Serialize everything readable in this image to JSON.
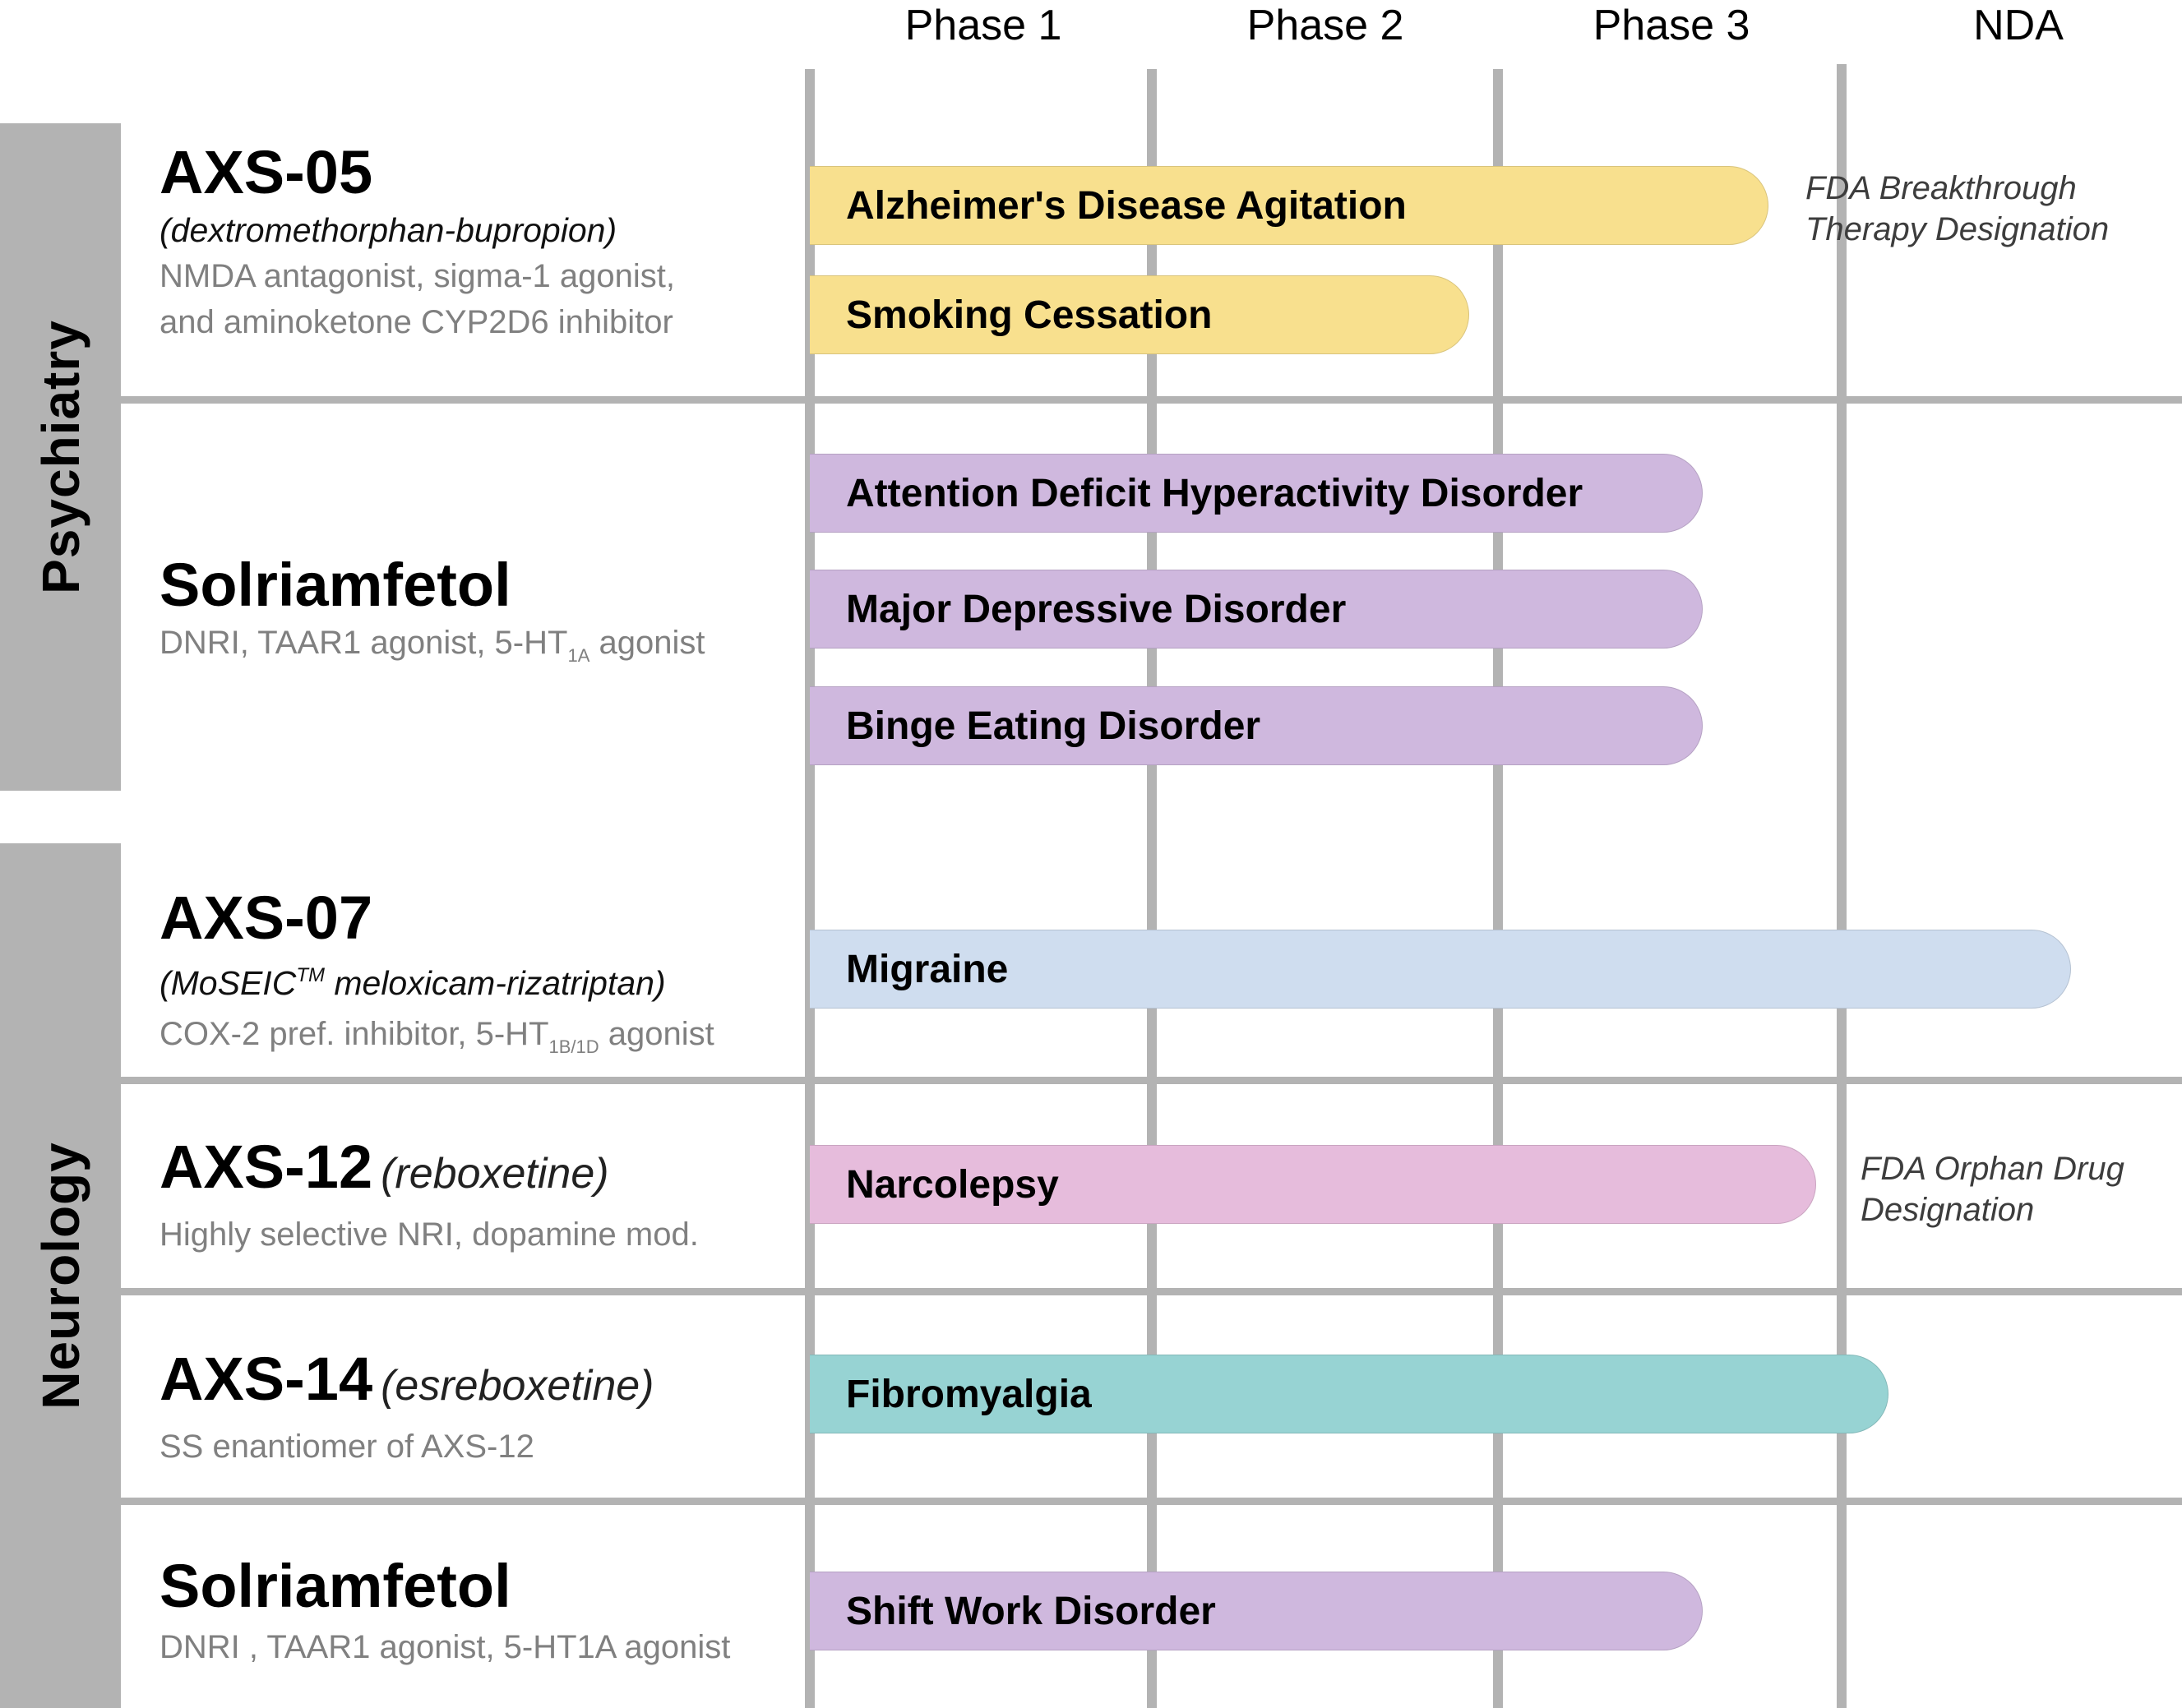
{
  "header": {
    "phases": [
      "Phase 1",
      "Phase 2",
      "Phase 3",
      "NDA"
    ]
  },
  "categories": {
    "psychiatry": "Psychiatry",
    "neurology": "Neurology"
  },
  "drugs": [
    {
      "name": "AXS-05",
      "compound": "(dextromethorphan-bupropion)",
      "mechanism_line1": "NMDA antagonist, sigma-1 agonist,",
      "mechanism_line2": "and aminoketone CYP2D6 inhibitor"
    },
    {
      "name": "Solriamfetol",
      "mechanism_pre": "DNRI, TAAR1 agonist, 5-HT",
      "mechanism_sub": "1A",
      "mechanism_post": " agonist"
    },
    {
      "name": "AXS-07",
      "compound_pre": "(MoSEIC",
      "compound_sup": "TM",
      "compound_post": " meloxicam-rizatriptan)",
      "mechanism_pre": "COX-2 pref. inhibitor, 5-HT",
      "mechanism_sub": "1B/1D",
      "mechanism_post": " agonist"
    },
    {
      "name": "AXS-12",
      "compound": "(reboxetine)",
      "mechanism": "Highly selective NRI, dopamine mod."
    },
    {
      "name": "AXS-14",
      "compound": "(esreboxetine)",
      "mechanism": "SS enantiomer of AXS-12"
    },
    {
      "name": "Solriamfetol",
      "mechanism": "DNRI , TAAR1 agonist, 5-HT1A agonist"
    }
  ],
  "notes": {
    "breakthrough_line1": "FDA Breakthrough",
    "breakthrough_line2": "Therapy Designation",
    "orphan_line1": "FDA Orphan Drug",
    "orphan_line2": "Designation"
  },
  "colors": {
    "yellow": "#f8e08e",
    "purple": "#cfb8de",
    "blue": "#cfddef",
    "pink": "#e6bcdc",
    "teal": "#97d3d3",
    "grid": "#b3b3b3",
    "band": "#b3b3b3"
  },
  "chart_data": {
    "type": "bar",
    "orientation": "horizontal",
    "title": "",
    "xlabel": "",
    "ylabel": "",
    "x_categories": [
      "Phase 1",
      "Phase 2",
      "Phase 3",
      "NDA"
    ],
    "xlim": [
      0,
      4
    ],
    "units": "phase columns progressed (0 = start of Phase 1, 4 = end of NDA)",
    "grid": true,
    "series": [
      {
        "drug": "AXS-05",
        "indication": "Alzheimer's Disease Agitation",
        "category": "Psychiatry",
        "progress": 2.79,
        "color": "yellow",
        "note": "breakthrough"
      },
      {
        "drug": "AXS-05",
        "indication": "Smoking Cessation",
        "category": "Psychiatry",
        "progress": 1.92,
        "color": "yellow"
      },
      {
        "drug": "Solriamfetol",
        "indication": "Attention Deficit Hyperactivity Disorder",
        "category": "Psychiatry",
        "progress": 2.6,
        "color": "purple"
      },
      {
        "drug": "Solriamfetol",
        "indication": "Major Depressive Disorder",
        "category": "Psychiatry",
        "progress": 2.6,
        "color": "purple"
      },
      {
        "drug": "Solriamfetol",
        "indication": "Binge Eating Disorder",
        "category": "Psychiatry",
        "progress": 2.6,
        "color": "purple"
      },
      {
        "drug": "AXS-07",
        "indication": "Migraine",
        "category": "Neurology",
        "progress": 3.67,
        "color": "blue"
      },
      {
        "drug": "AXS-12",
        "indication": "Narcolepsy",
        "category": "Neurology",
        "progress": 2.93,
        "color": "pink",
        "note": "orphan"
      },
      {
        "drug": "AXS-14",
        "indication": "Fibromyalgia",
        "category": "Neurology",
        "progress": 3.14,
        "color": "teal"
      },
      {
        "drug": "Solriamfetol",
        "indication": "Shift Work Disorder",
        "category": "Neurology",
        "progress": 2.6,
        "color": "purple"
      }
    ]
  }
}
